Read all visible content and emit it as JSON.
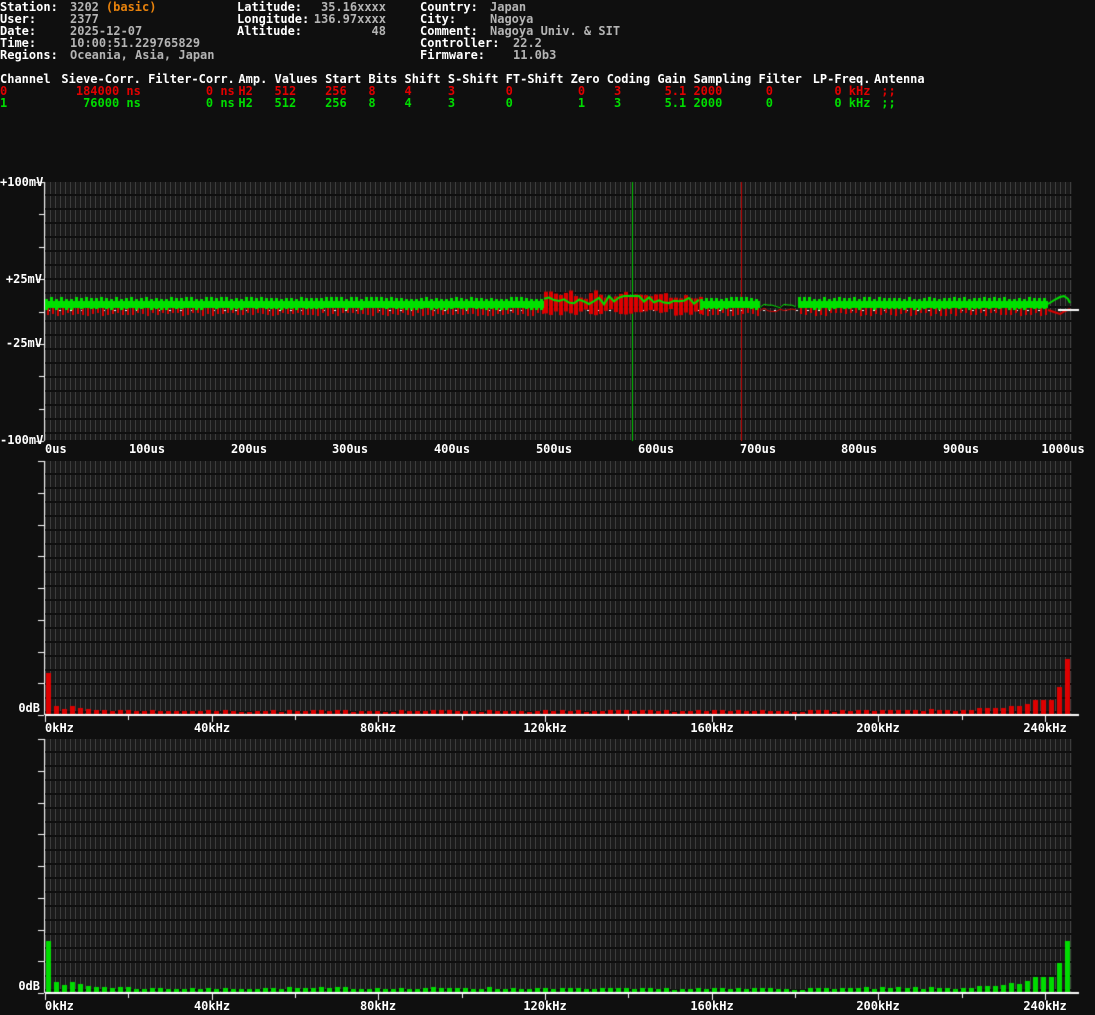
{
  "header": {
    "col1": [
      {
        "label": "Station:",
        "value": "3202",
        "suffix": "(basic)"
      },
      {
        "label": "User:",
        "value": "2377"
      },
      {
        "label": "Date:",
        "value": "2025-12-07"
      },
      {
        "label": "Time:",
        "value": "10:00:51.229765829"
      },
      {
        "label": "Regions:",
        "value": "Oceania, Asia, Japan"
      }
    ],
    "col2": [
      {
        "label": "Latitude:",
        "value": "35.16xxxx"
      },
      {
        "label": "Longitude:",
        "value": "136.97xxxx"
      },
      {
        "label": "Altitude:",
        "value": "48"
      }
    ],
    "col3": [
      {
        "label": "Country:",
        "value": "Japan"
      },
      {
        "label": "City:",
        "value": "Nagoya"
      },
      {
        "label": "Comment:",
        "value": "Nagoya Univ. & SIT"
      },
      {
        "label": "Controller:",
        "value": "22.2"
      },
      {
        "label": "Firmware:",
        "value": "11.0b3"
      }
    ]
  },
  "channels_table": {
    "columns": [
      "Channel",
      "Sieve-Corr.",
      "Filter-Corr.",
      "Amp.",
      "Values",
      "Start",
      "Bits",
      "Shift",
      "S-Shift",
      "FT-Shift",
      "Zero",
      "Coding",
      "Gain",
      "Sampling",
      "Filter",
      "LP-Freq.",
      "Antenna"
    ],
    "rows": [
      {
        "channel": "0",
        "color": "#e00000",
        "cells": [
          "0",
          "184000 ns",
          "0 ns",
          "H2",
          "512",
          "256",
          "8",
          "4",
          "3",
          "0",
          "0",
          "3",
          "5.1",
          "2000",
          "0",
          "0 kHz",
          ";;"
        ]
      },
      {
        "channel": "1",
        "color": "#00dc00",
        "cells": [
          "1",
          "76000 ns",
          "0 ns",
          "H2",
          "512",
          "256",
          "8",
          "4",
          "3",
          "0",
          "1",
          "3",
          "5.1",
          "2000",
          "0",
          "0 kHz",
          ";;"
        ]
      }
    ]
  },
  "chart_data": [
    {
      "type": "line",
      "name": "signal-waveform",
      "x_unit": "us",
      "x_min": 0,
      "x_max": 1009,
      "x_ticks": [
        {
          "t": 0,
          "label": "0us"
        },
        {
          "t": 100,
          "label": "100us"
        },
        {
          "t": 200,
          "label": "200us"
        },
        {
          "t": 300,
          "label": "300us"
        },
        {
          "t": 400,
          "label": "400us"
        },
        {
          "t": 500,
          "label": "500us"
        },
        {
          "t": 600,
          "label": "600us"
        },
        {
          "t": 700,
          "label": "700us"
        },
        {
          "t": 800,
          "label": "800us"
        },
        {
          "t": 900,
          "label": "900us"
        },
        {
          "t": 1000,
          "label": "1000us"
        }
      ],
      "y_unit": "mV",
      "y_min": -100,
      "y_max": 100,
      "y_tick_step": 25,
      "y_labels": [
        {
          "v": 100,
          "label": "+100mV"
        },
        {
          "v": 25,
          "label": "+25mV"
        },
        {
          "v": -25,
          "label": "-25mV"
        },
        {
          "v": -100,
          "label": "-100mV"
        }
      ],
      "series": [
        {
          "name": "channel-0",
          "color": "#de0000"
        },
        {
          "name": "channel-1",
          "color": "#00e000"
        }
      ],
      "baseline_amplitude_mV": 6,
      "segments": [
        {
          "from_us": 0,
          "to_us": 490,
          "mode": "comb"
        },
        {
          "from_us": 490,
          "to_us": 643,
          "mode": "disturbed"
        },
        {
          "from_us": 643,
          "to_us": 702,
          "mode": "comb"
        },
        {
          "from_us": 702,
          "to_us": 740,
          "mode": "quiet"
        },
        {
          "from_us": 740,
          "to_us": 985,
          "mode": "comb"
        },
        {
          "from_us": 985,
          "to_us": 1007,
          "mode": "end-blip"
        }
      ],
      "markers": [
        {
          "name": "trigger-marker-ch1",
          "t_us": 577,
          "color": "#00c800"
        },
        {
          "name": "trigger-marker-ch0",
          "t_us": 684,
          "color": "#c80000"
        }
      ],
      "zero_line_color": "#ffffff"
    },
    {
      "type": "bar",
      "name": "spectrum-channel-0",
      "color": "#de0000",
      "baseline_label": "0dB",
      "x_unit": "kHz",
      "x_ticks": [
        {
          "f": 0,
          "label": "0kHz"
        },
        {
          "f": 40,
          "label": "40kHz"
        },
        {
          "f": 80,
          "label": "80kHz"
        },
        {
          "f": 120,
          "label": "120kHz"
        },
        {
          "f": 160,
          "label": "160kHz"
        },
        {
          "f": 200,
          "label": "200kHz"
        },
        {
          "f": 240,
          "label": "240kHz"
        }
      ],
      "minor_ticks": [
        20,
        60,
        100,
        140,
        180,
        220
      ],
      "n_bins": 128,
      "bin_width_kHz": 2,
      "envelope": [
        [
          0,
          0.16
        ],
        [
          1,
          0.045
        ],
        [
          2,
          0.028
        ],
        [
          4,
          0.02
        ],
        [
          8,
          0.015
        ],
        [
          16,
          0.012
        ],
        [
          40,
          0.013
        ],
        [
          70,
          0.012
        ],
        [
          100,
          0.013
        ],
        [
          112,
          0.015
        ],
        [
          118,
          0.02
        ],
        [
          121,
          0.028
        ],
        [
          123,
          0.042
        ],
        [
          125,
          0.065
        ],
        [
          126,
          0.1
        ],
        [
          127,
          0.215
        ]
      ]
    },
    {
      "type": "bar",
      "name": "spectrum-channel-1",
      "color": "#00dc00",
      "baseline_label": "0dB",
      "x_unit": "kHz",
      "x_ticks": [
        {
          "f": 0,
          "label": "0kHz"
        },
        {
          "f": 40,
          "label": "40kHz"
        },
        {
          "f": 80,
          "label": "80kHz"
        },
        {
          "f": 120,
          "label": "120kHz"
        },
        {
          "f": 160,
          "label": "160kHz"
        },
        {
          "f": 200,
          "label": "200kHz"
        },
        {
          "f": 240,
          "label": "240kHz"
        }
      ],
      "minor_ticks": [
        20,
        60,
        100,
        140,
        180,
        220
      ],
      "n_bins": 128,
      "bin_width_kHz": 2,
      "envelope": [
        [
          0,
          0.2
        ],
        [
          1,
          0.055
        ],
        [
          2,
          0.04
        ],
        [
          3,
          0.032
        ],
        [
          5,
          0.024
        ],
        [
          8,
          0.018
        ],
        [
          14,
          0.014
        ],
        [
          24,
          0.013
        ],
        [
          34,
          0.016
        ],
        [
          44,
          0.014
        ],
        [
          54,
          0.016
        ],
        [
          64,
          0.013
        ],
        [
          80,
          0.013
        ],
        [
          100,
          0.014
        ],
        [
          112,
          0.016
        ],
        [
          118,
          0.022
        ],
        [
          121,
          0.03
        ],
        [
          123,
          0.046
        ],
        [
          125,
          0.07
        ],
        [
          126,
          0.11
        ],
        [
          127,
          0.2
        ]
      ]
    }
  ],
  "colors": {
    "background": "#0f0f0f",
    "grid_line": "#3c3c3c",
    "label_white": "#ffffff",
    "value_gray": "#b4b4b4",
    "accent_orange": "#e8820c",
    "channel0_red": "#de0000",
    "channel1_green": "#00dc00"
  }
}
